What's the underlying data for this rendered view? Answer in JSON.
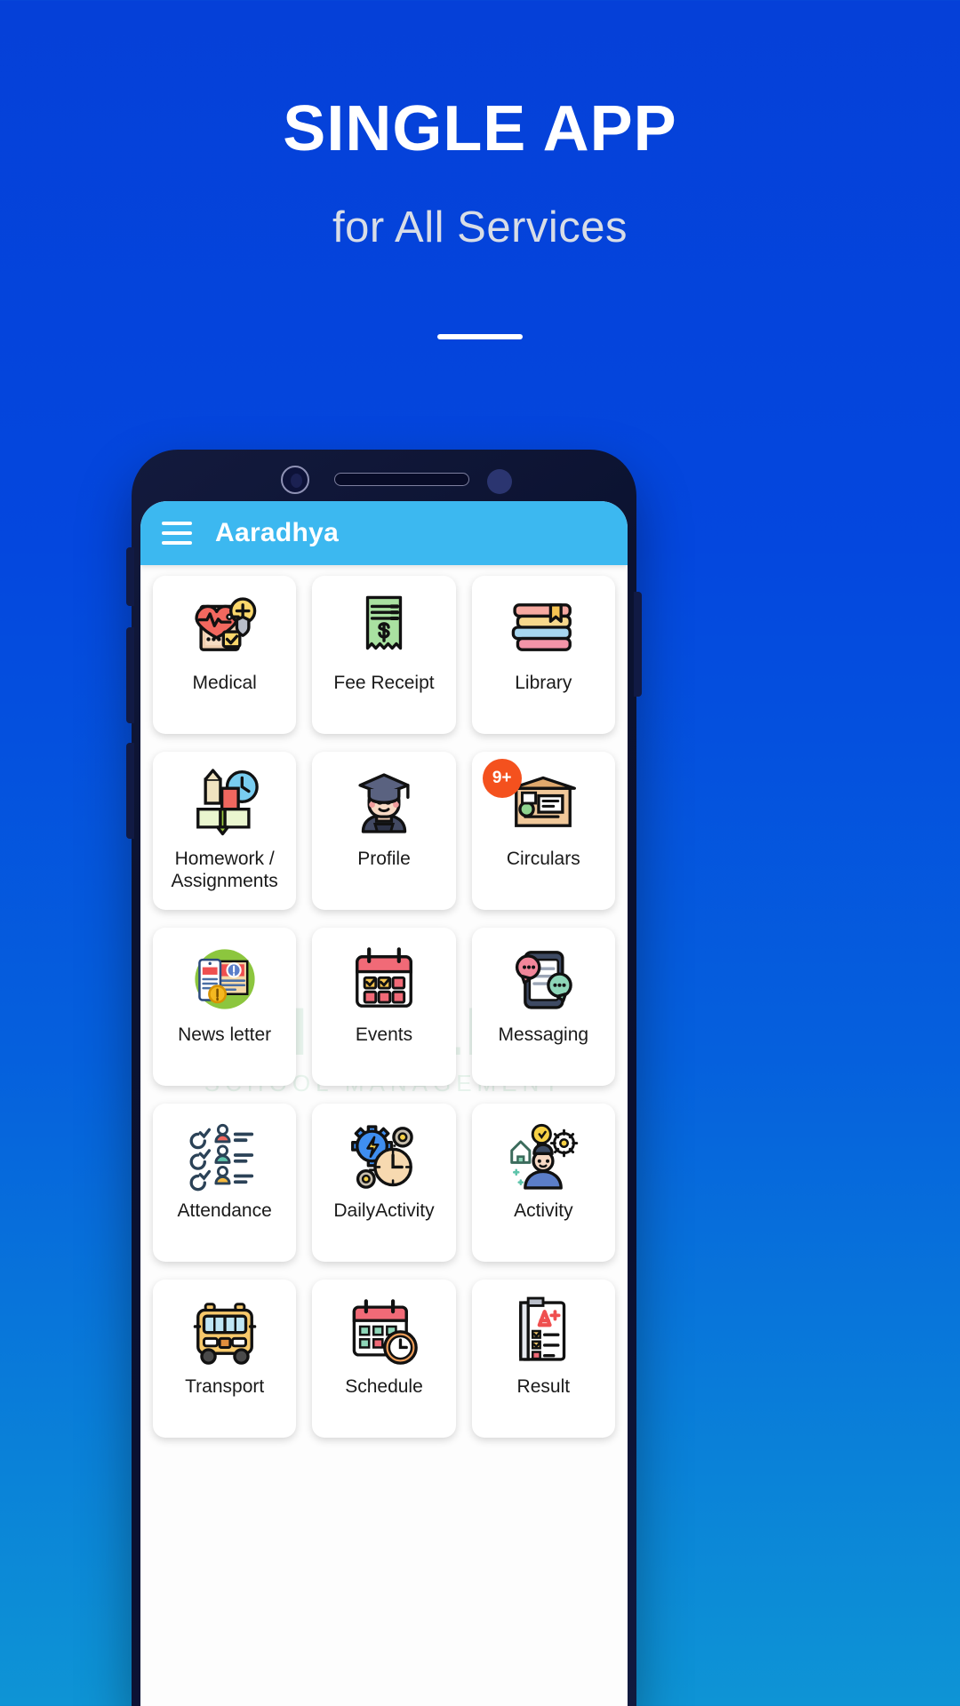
{
  "hero": {
    "title": "SINGLE APP",
    "subtitle": "for All Services"
  },
  "phone": {
    "appbar": {
      "menu_icon": "hamburger-menu-icon",
      "title": "Aaradhya"
    },
    "watermark": {
      "line1": "SCHOOLEYE",
      "line2": "SCHOOL MANAGEMENT"
    },
    "grid": {
      "tiles": [
        {
          "label": "Medical",
          "icon": "medical-clipboard-icon",
          "badge": null
        },
        {
          "label": "Fee Receipt",
          "icon": "receipt-icon",
          "badge": null
        },
        {
          "label": "Library",
          "icon": "books-stack-icon",
          "badge": null
        },
        {
          "label": "Homework /\nAssignments",
          "icon": "open-book-clock-icon",
          "badge": null
        },
        {
          "label": "Profile",
          "icon": "graduate-avatar-icon",
          "badge": null
        },
        {
          "label": "Circulars",
          "icon": "noticeboard-icon",
          "badge": "9+"
        },
        {
          "label": "News letter",
          "icon": "newsletter-phone-icon",
          "badge": null
        },
        {
          "label": "Events",
          "icon": "calendar-checks-icon",
          "badge": null
        },
        {
          "label": "Messaging",
          "icon": "chat-phone-icon",
          "badge": null
        },
        {
          "label": "Attendance",
          "icon": "attendance-list-icon",
          "badge": null
        },
        {
          "label": "DailyActivity",
          "icon": "gear-clock-icon",
          "badge": null
        },
        {
          "label": "Activity",
          "icon": "idea-person-gear-icon",
          "badge": null
        },
        {
          "label": "Transport",
          "icon": "school-bus-icon",
          "badge": null
        },
        {
          "label": "Schedule",
          "icon": "calendar-clock-icon",
          "badge": null
        },
        {
          "label": "Result",
          "icon": "report-card-icon",
          "badge": null
        }
      ]
    }
  },
  "colors": {
    "background_blue": "#0540d8",
    "appbar_blue": "#3cb8f0",
    "badge_orange": "#f4511e",
    "tile_white": "#ffffff",
    "hero_subtitle_grey": "#d8dde6"
  }
}
